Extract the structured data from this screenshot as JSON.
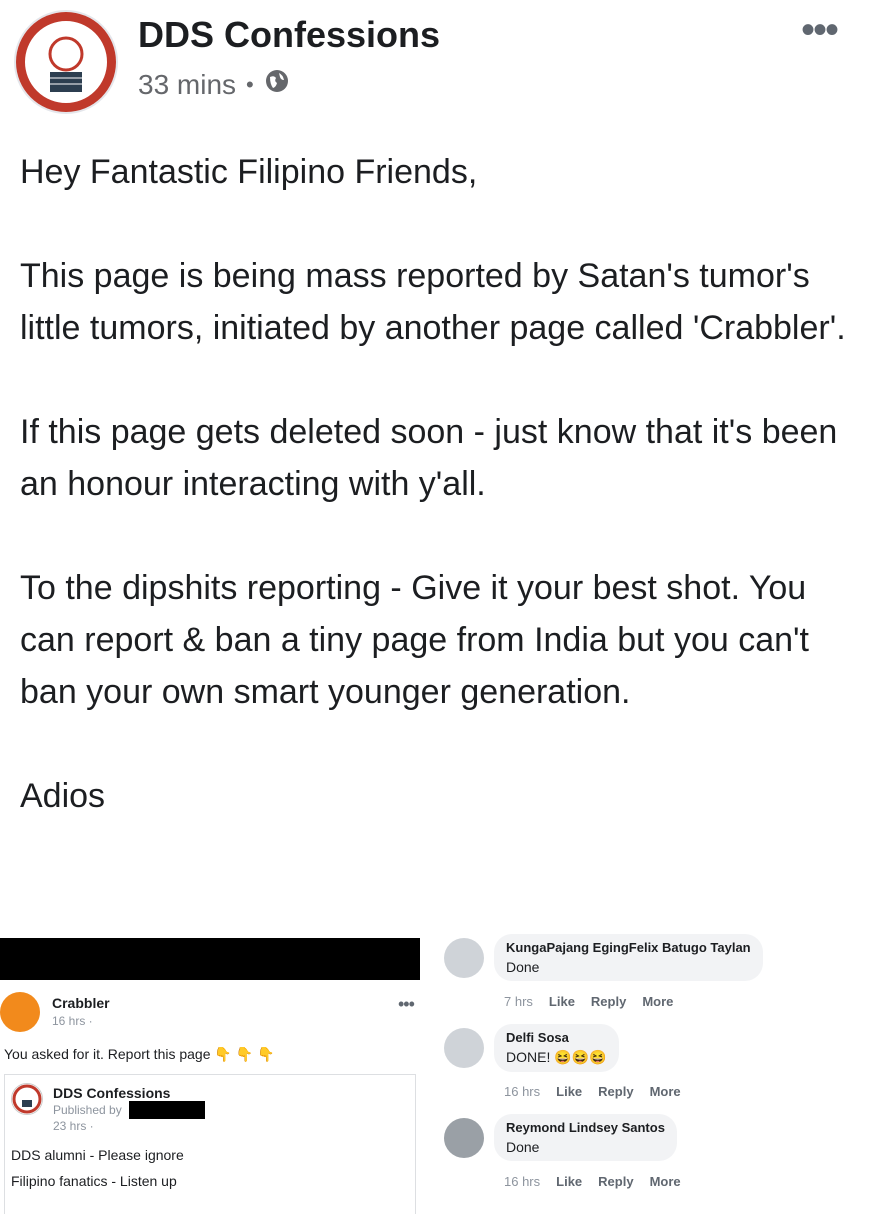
{
  "post": {
    "page_name": "DDS Confessions",
    "time": "33 mins",
    "separator": "•",
    "privacy_icon": "globe-icon",
    "more_icon": "•••",
    "paragraphs": [
      "Hey Fantastic Filipino Friends,",
      "This page is being mass reported by Satan's tumor's little tumors, initiated by another page called 'Crabbler'.",
      "If this page gets deleted soon - just know that it's been an honour interacting with y'all.",
      "To the dipshits reporting - Give it your best shot. You can report & ban a tiny page from India but you can't ban your own smart younger generation.",
      "Adios"
    ]
  },
  "screenshot": {
    "crabbler": {
      "name": "Crabbler",
      "time": "16 hrs ·",
      "more": "•••",
      "text": "You asked for it. Report this page",
      "emojis": "👇 👇 👇"
    },
    "shared_post": {
      "name": "DDS Confessions",
      "published_by": "Published by",
      "time": "23 hrs ·",
      "line1": "DDS alumni - Please ignore",
      "line2": "Filipino fanatics - Listen up"
    },
    "comments": [
      {
        "name": "KungaPajang EgingFelix Batugo Taylan",
        "text": "Done",
        "time": "7 hrs",
        "like": "Like",
        "reply": "Reply",
        "more": "More"
      },
      {
        "name": "Delfi Sosa",
        "text": "DONE! 😆😆😆",
        "time": "16 hrs",
        "like": "Like",
        "reply": "Reply",
        "more": "More"
      },
      {
        "name": "Reymond Lindsey Santos",
        "text": "Done",
        "time": "16 hrs",
        "like": "Like",
        "reply": "Reply",
        "more": "More"
      }
    ]
  }
}
